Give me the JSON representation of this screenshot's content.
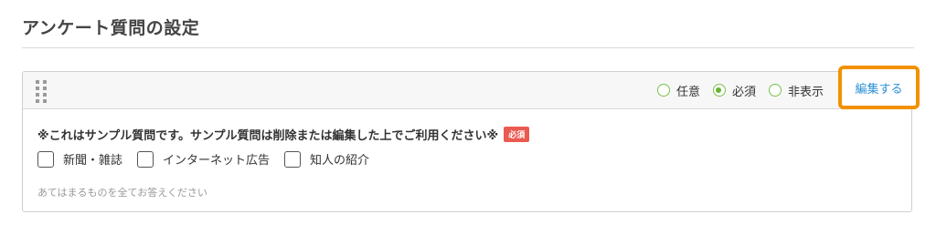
{
  "page": {
    "title": "アンケート質問の設定"
  },
  "question_card": {
    "visibility_options": [
      {
        "label": "任意",
        "selected": false
      },
      {
        "label": "必須",
        "selected": true
      },
      {
        "label": "非表示",
        "selected": false
      }
    ],
    "edit_label": "編集する",
    "question_text": "※これはサンプル質問です。サンプル質問は削除または編集した上でご利用ください※",
    "required_badge": "必須",
    "choices": [
      {
        "label": "新聞・雑誌",
        "checked": false
      },
      {
        "label": "インターネット広告",
        "checked": false
      },
      {
        "label": "知人の紹介",
        "checked": false
      }
    ],
    "hint": "あてはまるものを全てお答えください"
  },
  "colors": {
    "accent_green": "#6ab22f",
    "highlight_orange": "#f29100",
    "link_blue": "#2b8fd6",
    "required_red": "#ea5a50"
  }
}
